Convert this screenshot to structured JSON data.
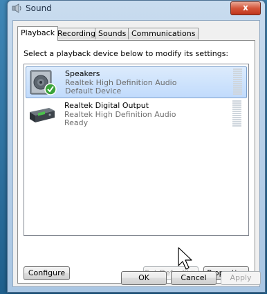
{
  "window": {
    "title": "Sound",
    "close_label": "x"
  },
  "tabs": [
    {
      "label": "Playback",
      "active": true
    },
    {
      "label": "Recording",
      "active": false
    },
    {
      "label": "Sounds",
      "active": false
    },
    {
      "label": "Communications",
      "active": false
    }
  ],
  "instruction": "Select a playback device below to modify its settings:",
  "devices": [
    {
      "name": "Speakers",
      "driver": "Realtek High Definition Audio",
      "status": "Default Device",
      "icon": "speaker-icon",
      "selected": true
    },
    {
      "name": "Realtek Digital Output",
      "driver": "Realtek High Definition Audio",
      "status": "Ready",
      "icon": "digital-output-icon",
      "selected": false
    }
  ],
  "buttons": {
    "configure": "Configure",
    "set_default": "Set Default",
    "properties": "Properties",
    "ok": "OK",
    "cancel": "Cancel",
    "apply": "Apply"
  },
  "colors": {
    "close": "#c0361c",
    "selection": "#c1dbfc",
    "check": "#3aa33a"
  }
}
